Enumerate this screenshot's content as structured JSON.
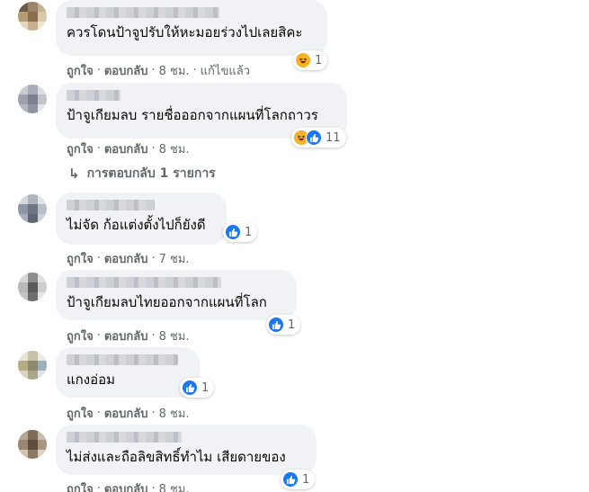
{
  "comments": [
    {
      "text": "ควรโดนป้าจูปรับให้หะมอยร่วงไปเลยสิคะ",
      "reaction_icons": [
        "haha-icon"
      ],
      "reaction_count": "1",
      "like_label": "ถูกใจ",
      "reply_label": "ตอบกลับ",
      "time": "8 ชม.",
      "edited_label": "แก้ไขแล้ว"
    },
    {
      "text": "ป้าจูเกียมลบ รายชื่อออกจากแผนที่โลกถาวร",
      "reaction_icons": [
        "haha-icon",
        "like-icon"
      ],
      "reaction_count": "11",
      "like_label": "ถูกใจ",
      "reply_label": "ตอบกลับ",
      "time": "8 ชม.",
      "replies_label": "การตอบกลับ 1 รายการ"
    },
    {
      "text": "ไม่จัด ก้อแต่งตั้งไปก็ยังดี",
      "reaction_icons": [
        "like-icon"
      ],
      "reaction_count": "1",
      "like_label": "ถูกใจ",
      "reply_label": "ตอบกลับ",
      "time": "7 ชม."
    },
    {
      "text": "ป้าจูเกียมลบไทยออกจากแผนที่โลก",
      "reaction_icons": [
        "like-icon"
      ],
      "reaction_count": "1",
      "like_label": "ถูกใจ",
      "reply_label": "ตอบกลับ",
      "time": "8 ชม."
    },
    {
      "text": "แกงอ่อม",
      "reaction_icons": [
        "like-icon"
      ],
      "reaction_count": "1",
      "like_label": "ถูกใจ",
      "reply_label": "ตอบกลับ",
      "time": "8 ชม."
    },
    {
      "text": "ไม่ส่งและถือลิขสิทธิ์ทำไม เสียดายของ",
      "reaction_icons": [
        "like-icon"
      ],
      "reaction_count": "1",
      "like_label": "ถูกใจ",
      "reply_label": "ตอบกลับ",
      "time": "8 ชม."
    }
  ],
  "colors": {
    "bubble": "#f0f2f5",
    "like": "#1877f2",
    "haha": "#f7b125",
    "meta_text": "#65676b"
  }
}
